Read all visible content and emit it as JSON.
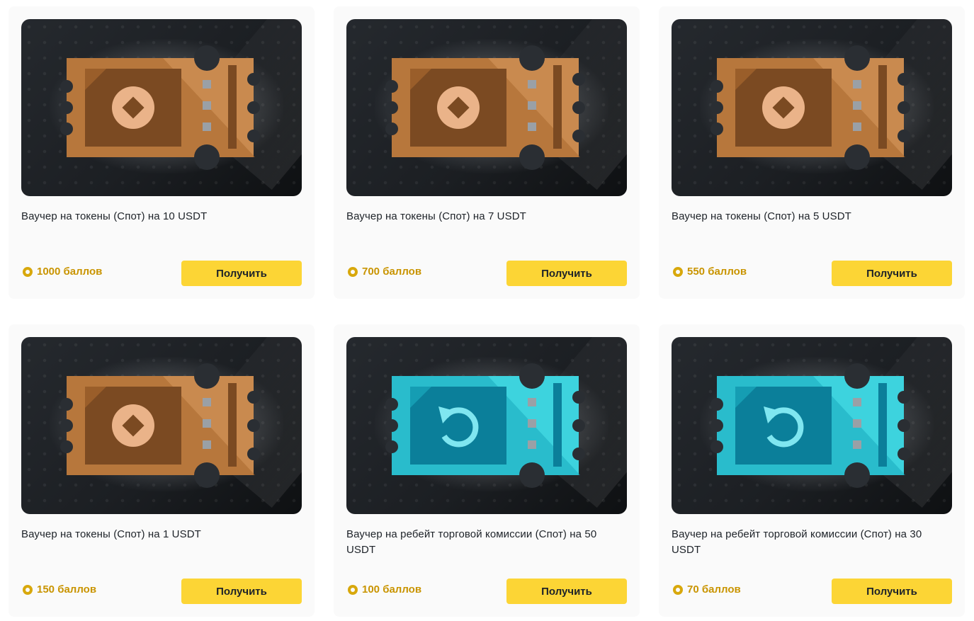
{
  "vouchers": [
    {
      "title": "Ваучер на токены (Спот) на 10 USDT",
      "points": "1000 баллов",
      "button": "Получить",
      "icon": "coin-diamond-icon",
      "ticket_colors": {
        "base": "#c98a4f",
        "shade": "#a8672e",
        "panel": "#7b4a22",
        "mark": "#eab389"
      }
    },
    {
      "title": "Ваучер на токены (Спот) на 7 USDT",
      "points": "700 баллов",
      "button": "Получить",
      "icon": "coin-diamond-icon",
      "ticket_colors": {
        "base": "#c98a4f",
        "shade": "#a8672e",
        "panel": "#7b4a22",
        "mark": "#eab389"
      }
    },
    {
      "title": "Ваучер на токены (Спот) на 5 USDT",
      "points": "550 баллов",
      "button": "Получить",
      "icon": "coin-diamond-icon",
      "ticket_colors": {
        "base": "#c98a4f",
        "shade": "#a8672e",
        "panel": "#7b4a22",
        "mark": "#eab389"
      }
    },
    {
      "title": "Ваучер на токены (Спот) на 1 USDT",
      "points": "150 баллов",
      "button": "Получить",
      "icon": "coin-diamond-icon",
      "ticket_colors": {
        "base": "#c98a4f",
        "shade": "#a8672e",
        "panel": "#7b4a22",
        "mark": "#eab389"
      }
    },
    {
      "title": "Ваучер на ребейт торговой комиссии (Спот) на 50 USDT",
      "points": "100 баллов",
      "button": "Получить",
      "icon": "rebate-arrow-icon",
      "ticket_colors": {
        "base": "#3dd3de",
        "shade": "#1aa9bd",
        "panel": "#0b7f9a",
        "mark": "#7fe6f0"
      }
    },
    {
      "title": "Ваучер на ребейт торговой комиссии (Спот) на 30 USDT",
      "points": "70 баллов",
      "button": "Получить",
      "icon": "rebate-arrow-icon",
      "ticket_colors": {
        "base": "#3dd3de",
        "shade": "#1aa9bd",
        "panel": "#0b7f9a",
        "mark": "#7fe6f0"
      }
    }
  ],
  "colors": {
    "button_bg": "#fcd535",
    "points_text": "#c99400",
    "card_bg": "#fafafa"
  }
}
